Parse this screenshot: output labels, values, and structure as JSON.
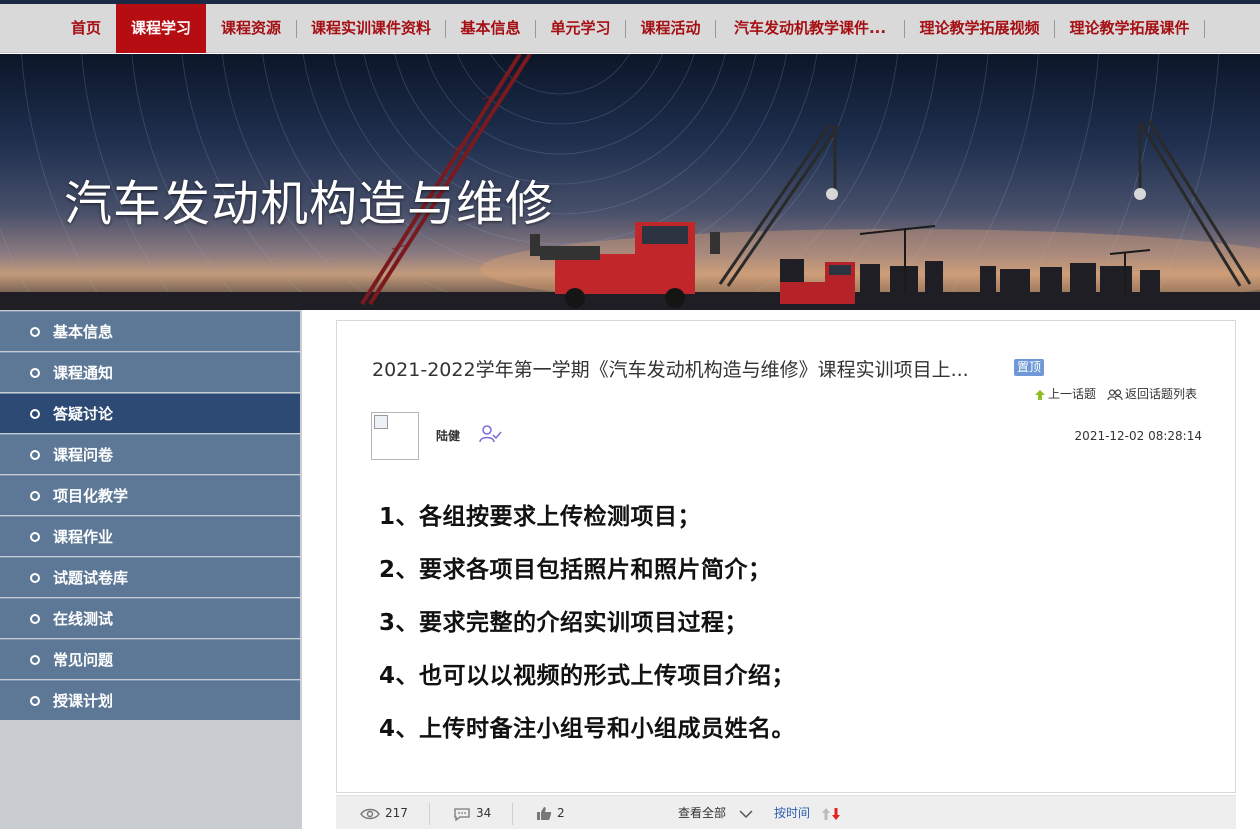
{
  "nav": {
    "items": [
      {
        "label": "首页"
      },
      {
        "label": "课程学习"
      },
      {
        "label": "课程资源"
      },
      {
        "label": "课程实训课件资料"
      },
      {
        "label": "基本信息"
      },
      {
        "label": "单元学习"
      },
      {
        "label": "课程活动"
      },
      {
        "label": "汽车发动机教学课件..."
      },
      {
        "label": "理论教学拓展视频"
      },
      {
        "label": "理论教学拓展课件"
      }
    ]
  },
  "banner": {
    "title": "汽车发动机构造与维修"
  },
  "sidebar": {
    "items": [
      {
        "label": "基本信息"
      },
      {
        "label": "课程通知"
      },
      {
        "label": "答疑讨论"
      },
      {
        "label": "课程问卷"
      },
      {
        "label": "项目化教学"
      },
      {
        "label": "课程作业"
      },
      {
        "label": "试题试卷库"
      },
      {
        "label": "在线测试"
      },
      {
        "label": "常见问题"
      },
      {
        "label": "授课计划"
      }
    ]
  },
  "post": {
    "title": "2021-2022学年第一学期《汽车发动机构造与维修》课程实训项目上...",
    "pin_badge": "置顶",
    "prev_link": "上一话题",
    "back_link": "返回话题列表",
    "author": "陆健",
    "time": "2021-12-02 08:28:14",
    "lines": [
      "1、各组按要求上传检测项目；",
      "2、要求各项目包括照片和照片简介；",
      "3、要求完整的介绍实训项目过程；",
      "4、也可以以视频的形式上传项目介绍；",
      "4、上传时备注小组号和小组成员姓名。"
    ]
  },
  "footer": {
    "views": "217",
    "comments": "34",
    "likes": "2",
    "view_all": "查看全部",
    "sort_by": "按时间"
  },
  "colors": {
    "nav_active": "#b50d12",
    "nav_text": "#a50f14",
    "sidebar_item": "#5d7897",
    "sidebar_active": "#2c4a73",
    "pin_badge": "#6e98d6"
  }
}
